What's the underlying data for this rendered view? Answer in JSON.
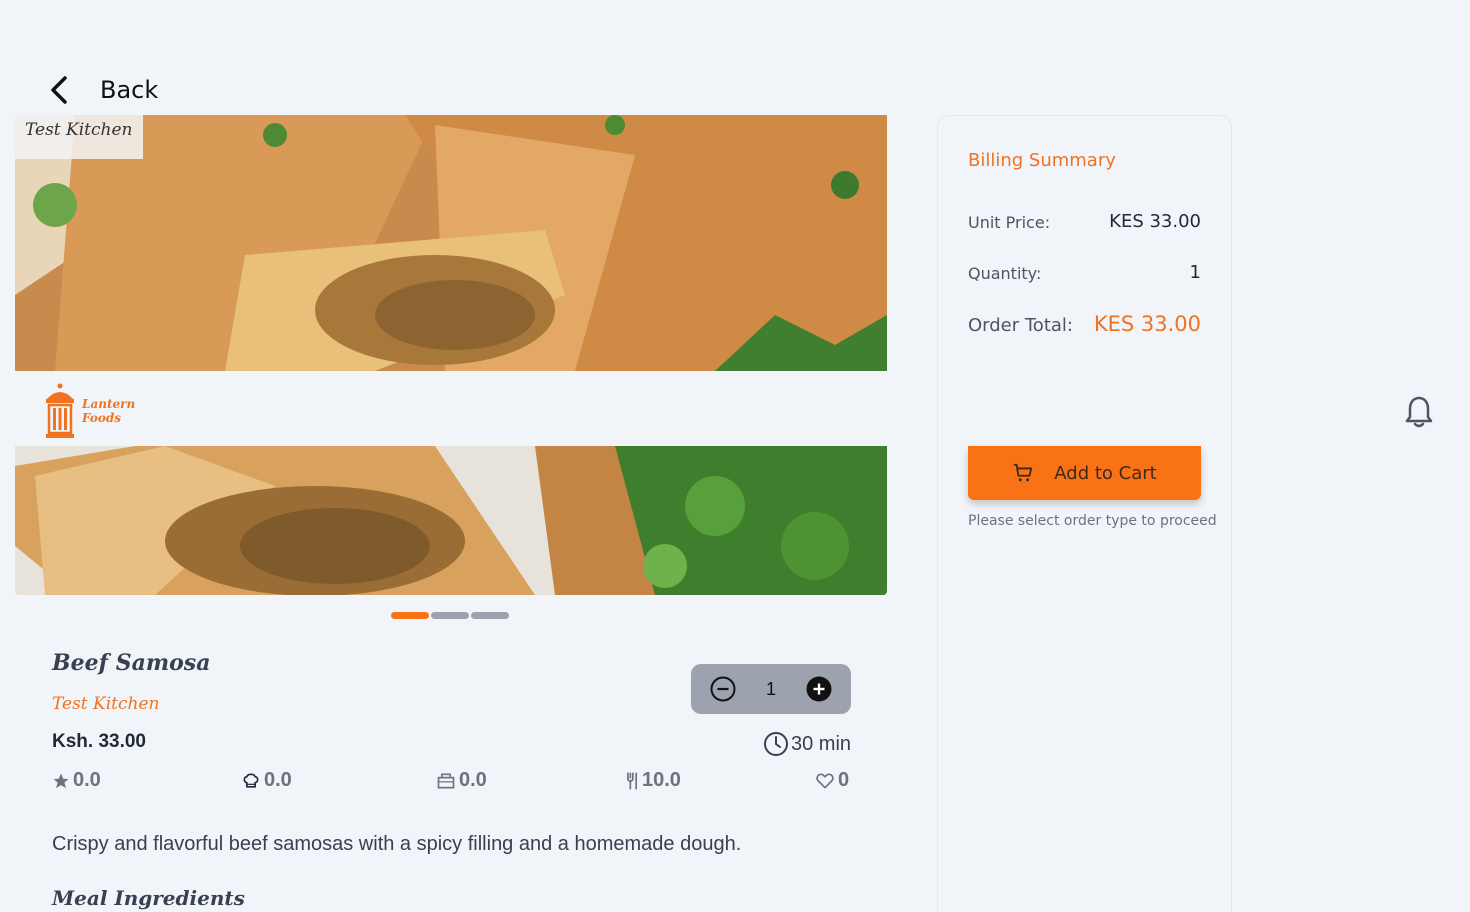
{
  "nav": {
    "back_label": "Back"
  },
  "gallery": {
    "kitchen_tag": "Test Kitchen",
    "slide_count": 3,
    "active_slide": 0
  },
  "brand": {
    "name_line1": "Lantern",
    "name_line2": "Foods",
    "accent_color": "#f97316"
  },
  "product": {
    "name": "Beef Samosa",
    "kitchen": "Test Kitchen",
    "price": "Ksh. 33.00",
    "quantity": "1",
    "prep_time": "30 min",
    "stats": {
      "rating": "0.0",
      "chef_rating": "0.0",
      "packaging_rating": "0.0",
      "meal_rating": "10.0",
      "likes": "0"
    },
    "description": "Crispy and flavorful beef samosas with a spicy filling and a homemade dough.",
    "ingredients_heading": "Meal Ingredients"
  },
  "billing": {
    "title": "Billing Summary",
    "unit_price_label": "Unit Price:",
    "unit_price_value": "KES 33.00",
    "quantity_label": "Quantity:",
    "quantity_value": "1",
    "total_label": "Order Total:",
    "total_value": "KES 33.00",
    "add_to_cart_label": "Add to Cart",
    "note": "Please select order type to proceed"
  }
}
